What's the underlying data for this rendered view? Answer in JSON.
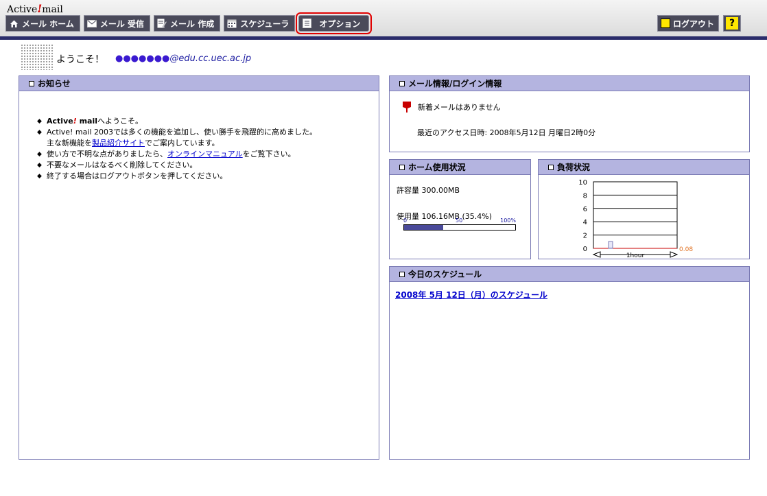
{
  "app": {
    "logo_a": "Active",
    "logo_bang": "!",
    "logo_b": "mail"
  },
  "nav": {
    "home": "メール ホーム",
    "receive": "メール 受信",
    "compose": "メール 作成",
    "scheduler": "スケジューラ",
    "options": "オプション"
  },
  "header_right": {
    "logout": "ログアウト",
    "help": "?"
  },
  "welcome": {
    "greeting": "ようこそ！",
    "address_masked": "●●●●●●●",
    "address_domain": "@edu.cc.uec.ac.jp"
  },
  "news": {
    "title": "お知らせ",
    "item1_brand_a": "Active",
    "item1_brand_bang": "!",
    "item1_brand_b": " mail",
    "item1_rest": "へようこそ。",
    "item2_line1": "Active! mail 2003では多くの機能を追加し、使い勝手を飛躍的に高めました。",
    "item2_line2_pre": "主な新機能を",
    "item2_link": "製品紹介サイト",
    "item2_line2_post": "でご案内しています。",
    "item3_pre": "使い方で不明な点がありましたら、",
    "item3_link": "オンラインマニュアル",
    "item3_post": "をご覧下さい。",
    "item4": "不要なメールはなるべく削除してください。",
    "item5": "終了する場合はログアウトボタンを押してください。"
  },
  "mail_info": {
    "title": "メール情報/ログイン情報",
    "no_new": "新着メールはありません",
    "last_access": "最近のアクセス日時:  2008年5月12日 月曜日2時0分"
  },
  "home_usage": {
    "title": "ホーム使用状況",
    "allowed": "許容量 300.00MB",
    "used": "使用量 106.16MB (35.4%)",
    "used_fraction": 0.354,
    "bar_label_0": "0",
    "bar_label_50": "50",
    "bar_label_100": "100%"
  },
  "load": {
    "title": "負荷状況",
    "value_label": "0.08",
    "x_label": "1hour"
  },
  "chart_data": {
    "type": "bar",
    "categories": [
      "1hour"
    ],
    "values": [
      0.08
    ],
    "yticks": [
      0,
      2,
      4,
      6,
      8,
      10
    ],
    "ylim": [
      0,
      10
    ],
    "grid": true
  },
  "schedule": {
    "title": "今日のスケジュール",
    "link": "2008年 5月 12日（月）のスケジュール"
  },
  "colors": {
    "panel_header": "#b4b4e0",
    "panel_border": "#7a7ab4",
    "nav_bg": "#4a4a5a",
    "accent_red": "#d40000"
  }
}
